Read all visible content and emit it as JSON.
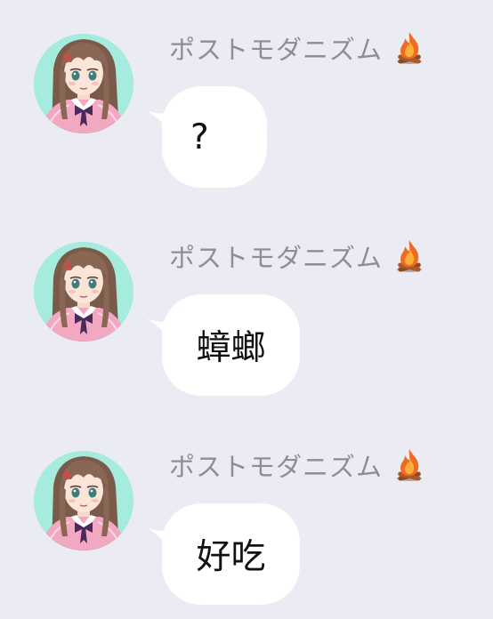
{
  "messages": [
    {
      "sender": "ポストモダニズム",
      "sender_badge_icon": "fire-icon",
      "avatar_icon": "anime-girl-avatar-icon",
      "text": "?"
    },
    {
      "sender": "ポストモダニズム",
      "sender_badge_icon": "fire-icon",
      "avatar_icon": "anime-girl-avatar-icon",
      "text": "蟑螂"
    },
    {
      "sender": "ポストモダニズム",
      "sender_badge_icon": "fire-icon",
      "avatar_icon": "anime-girl-avatar-icon",
      "text": "好吃"
    }
  ],
  "colors": {
    "background": "#ebebf3",
    "bubble": "#ffffff",
    "sender_name": "#8d8d98",
    "avatar_background": "#a5ecdf",
    "text": "#111111"
  }
}
